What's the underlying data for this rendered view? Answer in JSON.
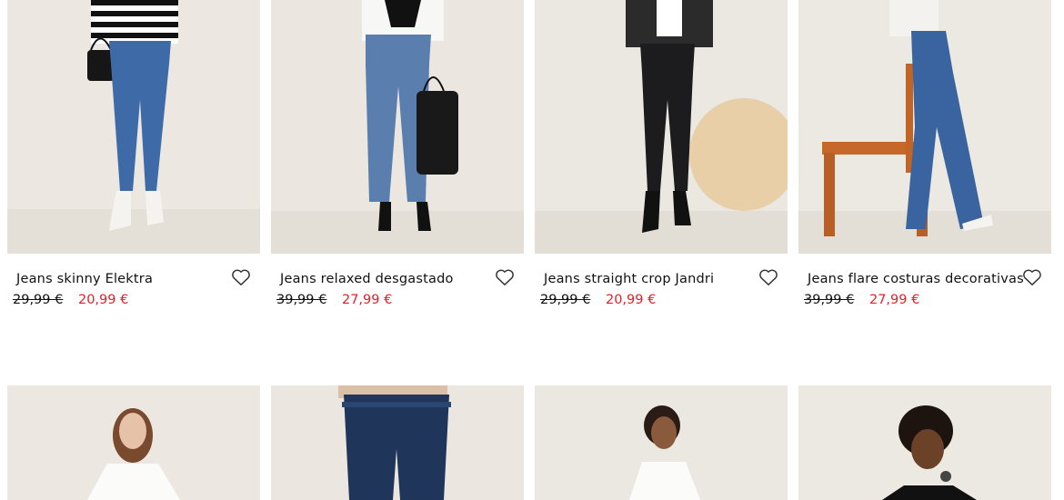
{
  "products": [
    {
      "name": "Jeans skinny Elektra",
      "old_price": "29,99 €",
      "price": "20,99 €"
    },
    {
      "name": "Jeans relaxed desgastado",
      "old_price": "39,99 €",
      "price": "27,99 €"
    },
    {
      "name": "Jeans straight crop Jandri",
      "old_price": "29,99 €",
      "price": "20,99 €"
    },
    {
      "name": "Jeans flare costuras decorativas",
      "old_price": "39,99 €",
      "price": "27,99 €"
    }
  ],
  "icons": {
    "favorite": "heart-outline-icon"
  },
  "colors": {
    "sale_price": "#e2202b",
    "image_bg": "#e9e5de",
    "denim": "#3f6aa8",
    "dark_denim": "#1f3559"
  }
}
